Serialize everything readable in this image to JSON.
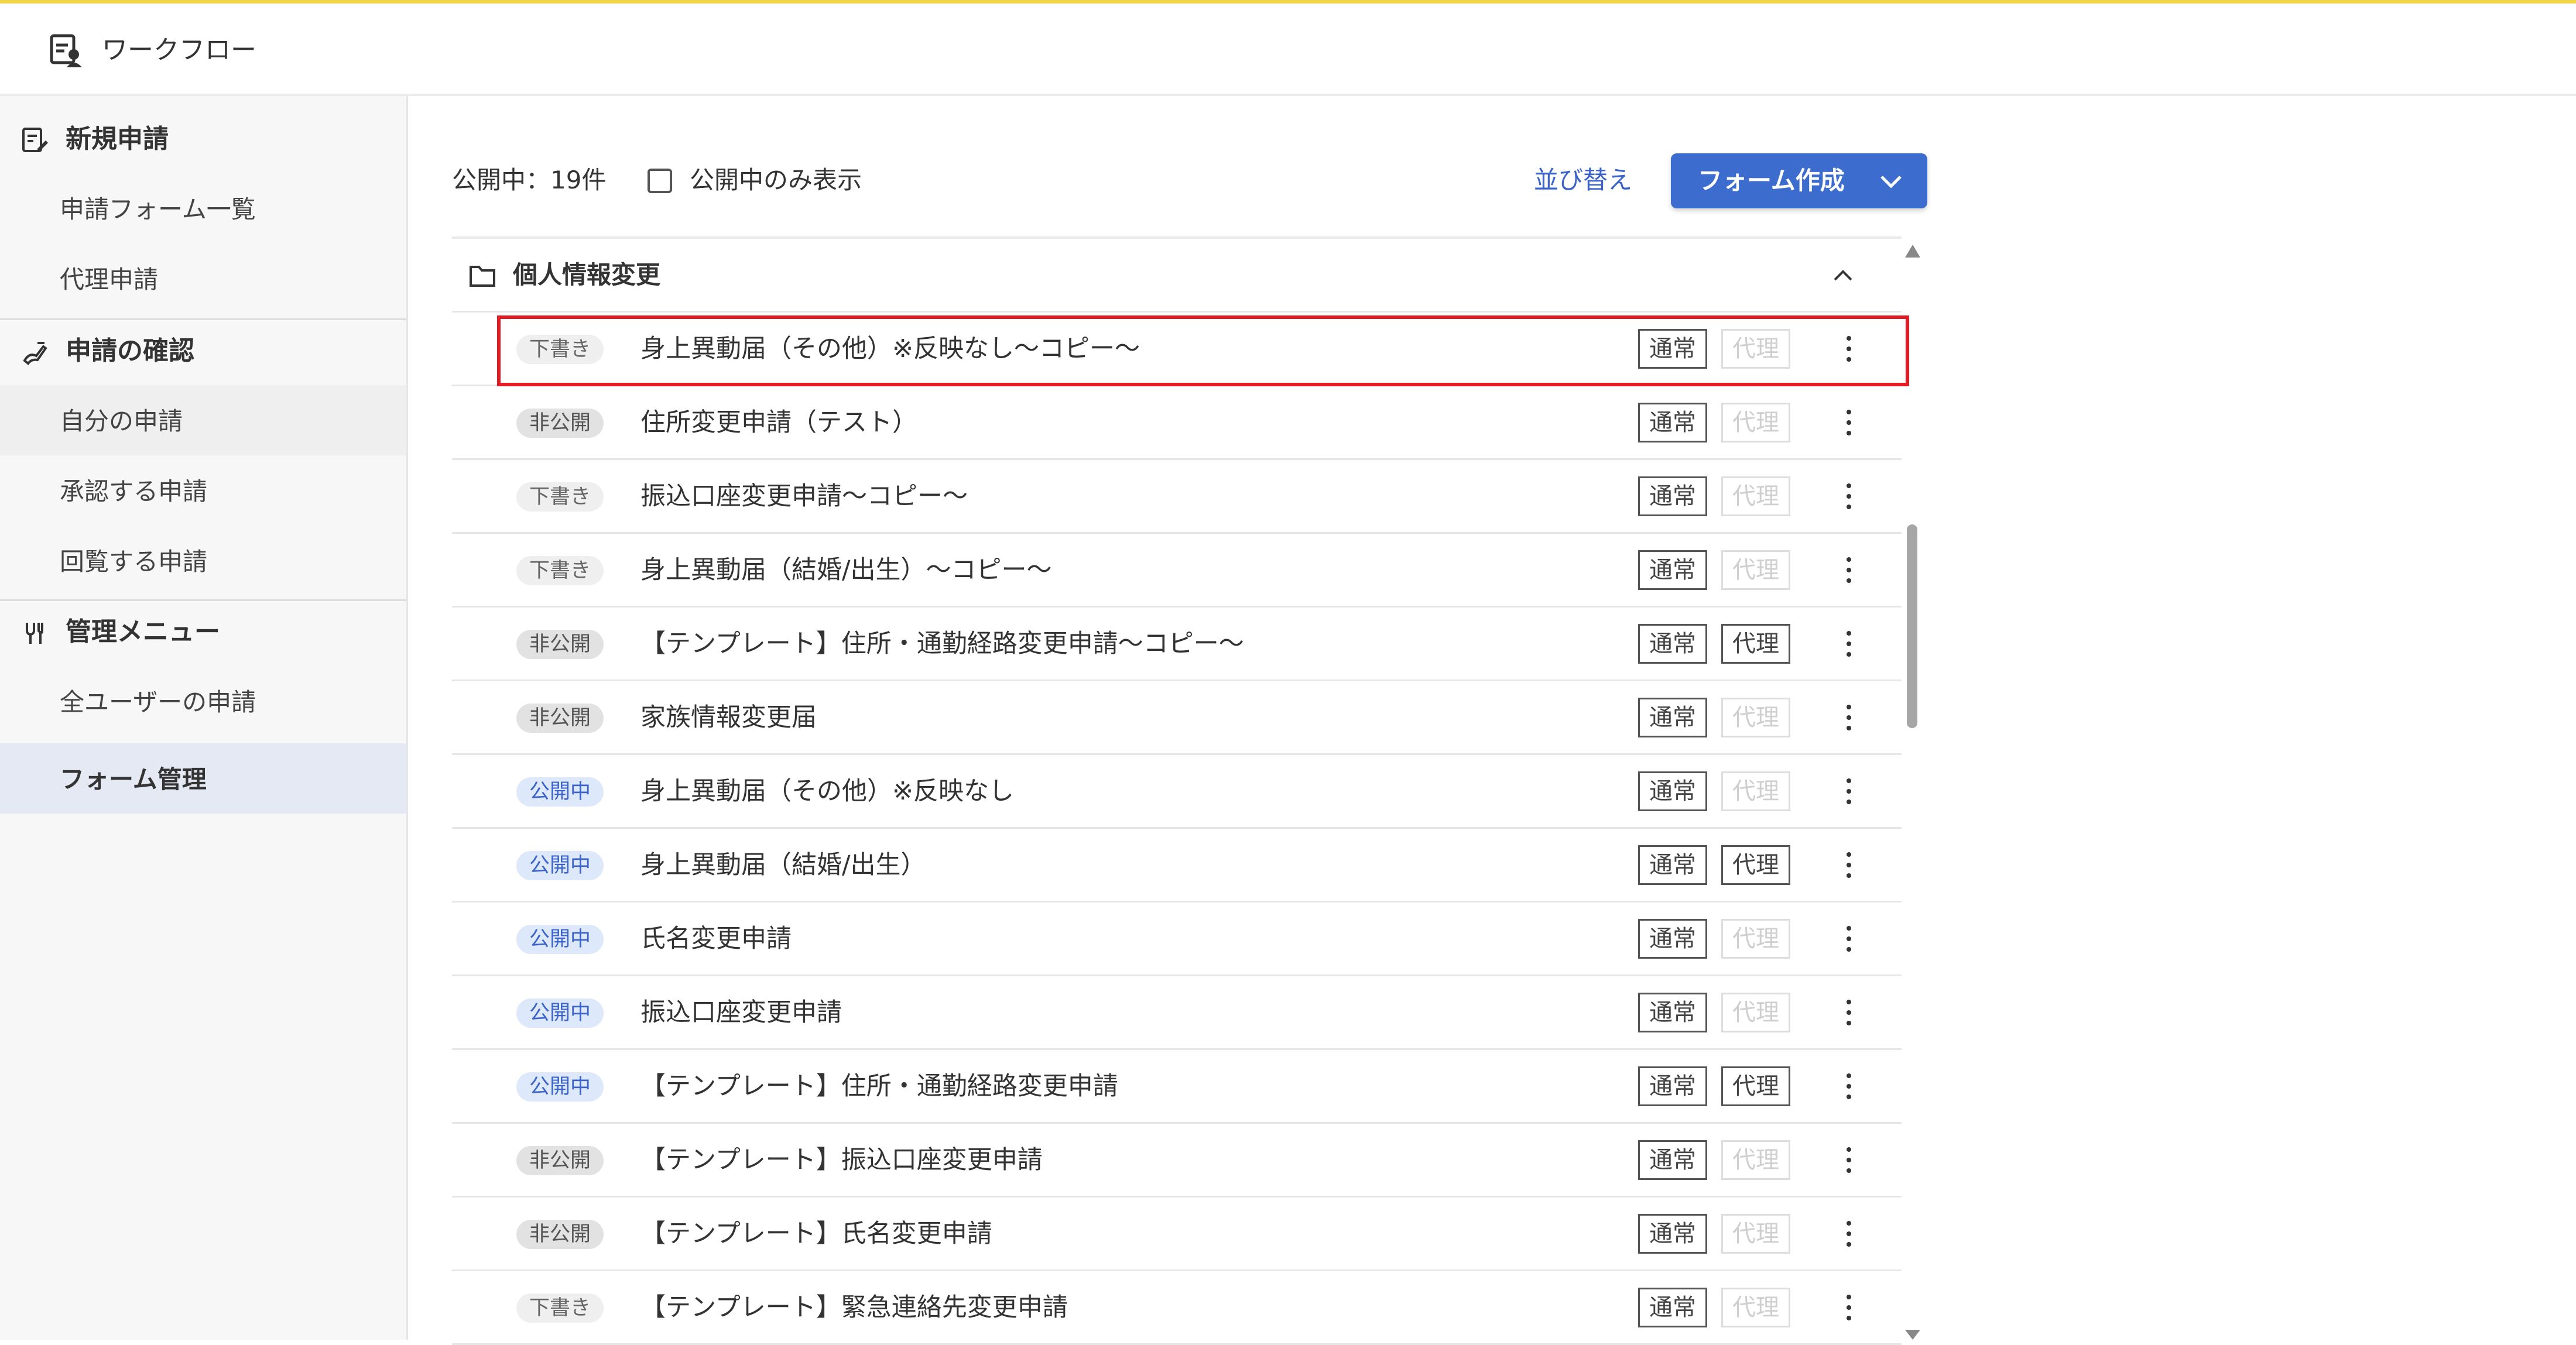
{
  "app": {
    "title": "ワークフロー",
    "icon": "workflow-pen-icon"
  },
  "sidebar": {
    "sections": [
      {
        "label": "新規申請",
        "icon": "new-application-icon",
        "items": [
          "申請フォーム一覧",
          "代理申請"
        ]
      },
      {
        "label": "申請の確認",
        "icon": "confirm-hand-icon",
        "items": [
          "自分の申請",
          "承認する申請",
          "回覧する申請"
        ]
      },
      {
        "label": "管理メニュー",
        "icon": "admin-wrench-icon",
        "items": [
          "全ユーザーの申請",
          "フォーム管理"
        ]
      }
    ],
    "active_item": "フォーム管理",
    "hovered_item": "自分の申請"
  },
  "toolbar": {
    "count_label": "公開中：19件",
    "filter_label": "公開中のみ表示",
    "filter_checked": false,
    "sort_label": "並び替え",
    "create_label": "フォーム作成",
    "create_icon": "chevron-down-icon"
  },
  "group": {
    "label": "個人情報変更",
    "icon": "folder-icon",
    "expanded": true,
    "toggle_icon": "chevron-up-icon"
  },
  "tag_labels": {
    "normal": "通常",
    "proxy": "代理"
  },
  "forms": [
    {
      "status": "下書き",
      "status_type": "draft",
      "title": "身上異動届（その他）※反映なし～コピー～",
      "proxy_enabled": false,
      "highlighted": true
    },
    {
      "status": "非公開",
      "status_type": "private",
      "title": "住所変更申請（テスト）",
      "proxy_enabled": false
    },
    {
      "status": "下書き",
      "status_type": "draft",
      "title": "振込口座変更申請～コピー～",
      "proxy_enabled": false
    },
    {
      "status": "下書き",
      "status_type": "draft",
      "title": "身上異動届（結婚/出生）～コピー～",
      "proxy_enabled": false
    },
    {
      "status": "非公開",
      "status_type": "private",
      "title": "【テンプレート】住所・通勤経路変更申請～コピー～",
      "proxy_enabled": true
    },
    {
      "status": "非公開",
      "status_type": "private",
      "title": "家族情報変更届",
      "proxy_enabled": false
    },
    {
      "status": "公開中",
      "status_type": "public",
      "title": "身上異動届（その他）※反映なし",
      "proxy_enabled": false
    },
    {
      "status": "公開中",
      "status_type": "public",
      "title": "身上異動届（結婚/出生）",
      "proxy_enabled": true
    },
    {
      "status": "公開中",
      "status_type": "public",
      "title": "氏名変更申請",
      "proxy_enabled": false
    },
    {
      "status": "公開中",
      "status_type": "public",
      "title": "振込口座変更申請",
      "proxy_enabled": false
    },
    {
      "status": "公開中",
      "status_type": "public",
      "title": "【テンプレート】住所・通勤経路変更申請",
      "proxy_enabled": true
    },
    {
      "status": "非公開",
      "status_type": "private",
      "title": "【テンプレート】振込口座変更申請",
      "proxy_enabled": false
    },
    {
      "status": "非公開",
      "status_type": "private",
      "title": "【テンプレート】氏名変更申請",
      "proxy_enabled": false
    },
    {
      "status": "下書き",
      "status_type": "draft",
      "title": "【テンプレート】緊急連絡先変更申請",
      "proxy_enabled": false
    }
  ],
  "colors": {
    "accent": "#3d6ccf",
    "link": "#3b63c9",
    "highlight_border": "#e31b23",
    "top_bar": "#f2d64a",
    "sidebar_active": "#e4e9f4"
  }
}
